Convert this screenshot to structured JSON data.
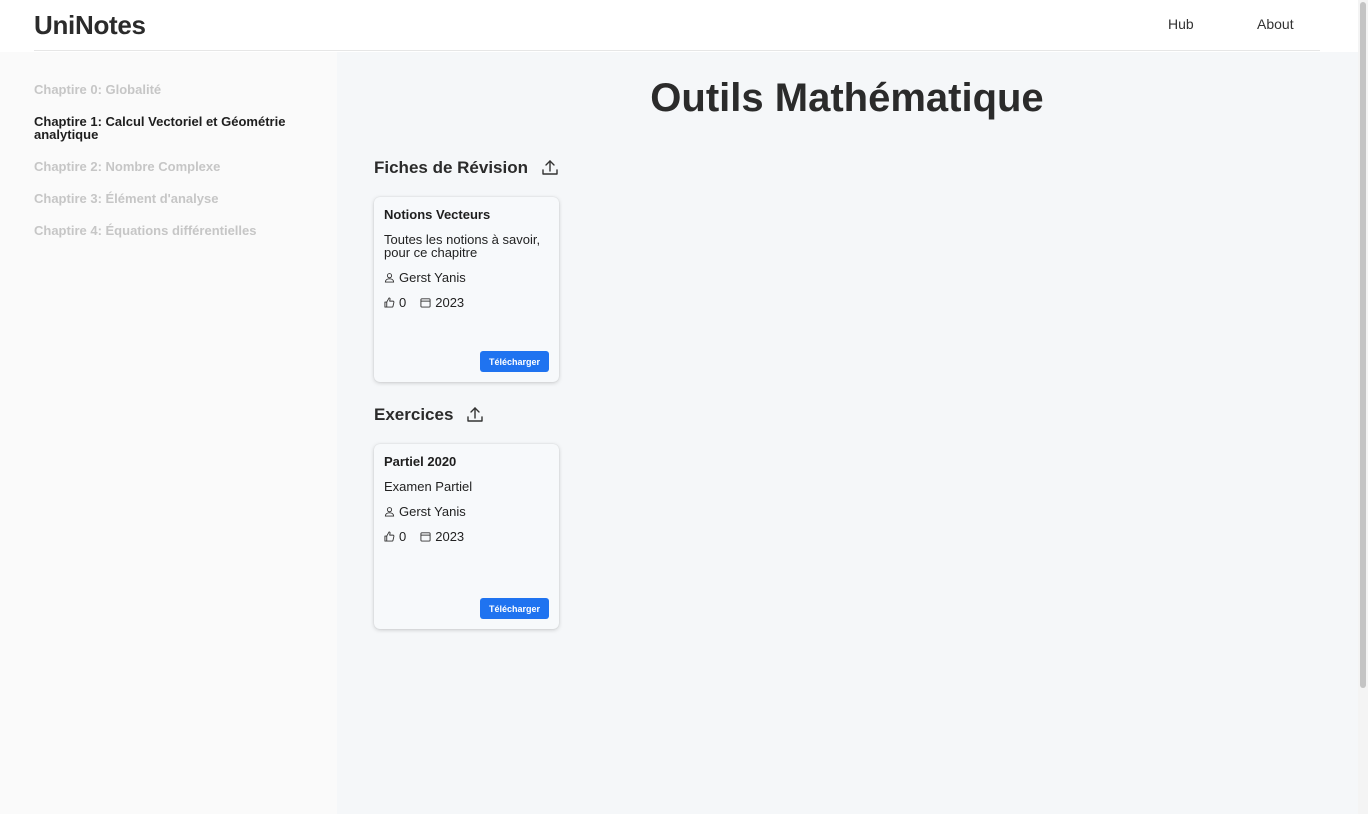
{
  "header": {
    "logo": "UniNotes",
    "nav": {
      "hub": "Hub",
      "about": "About"
    }
  },
  "sidebar": {
    "items": [
      {
        "label": "Chaptire 0: Globalité",
        "active": false
      },
      {
        "label": "Chaptire 1: Calcul Vectoriel et Géométrie analytique",
        "active": true
      },
      {
        "label": "Chaptire 2: Nombre Complexe",
        "active": false
      },
      {
        "label": "Chaptire 3: Élément d'analyse",
        "active": false
      },
      {
        "label": "Chaptire 4: Équations différentielles",
        "active": false
      }
    ]
  },
  "main": {
    "title": "Outils Mathématique",
    "sections": [
      {
        "title": "Fiches de Révision",
        "icon": "upload-icon",
        "cards": [
          {
            "title": "Notions Vecteurs",
            "description": "Toutes les notions à savoir, pour ce chapitre",
            "author": "Gerst Yanis",
            "likes": "0",
            "year": "2023",
            "button": "Télécharger"
          }
        ]
      },
      {
        "title": "Exercices",
        "icon": "upload-icon",
        "cards": [
          {
            "title": "Partiel 2020",
            "description": "Examen Partiel",
            "author": "Gerst Yanis",
            "likes": "0",
            "year": "2023",
            "button": "Télécharger"
          }
        ]
      }
    ]
  },
  "colors": {
    "accent": "#1f73f0",
    "sidebar_inactive": "#c6c6c6",
    "main_bg": "#f5f7f9"
  }
}
